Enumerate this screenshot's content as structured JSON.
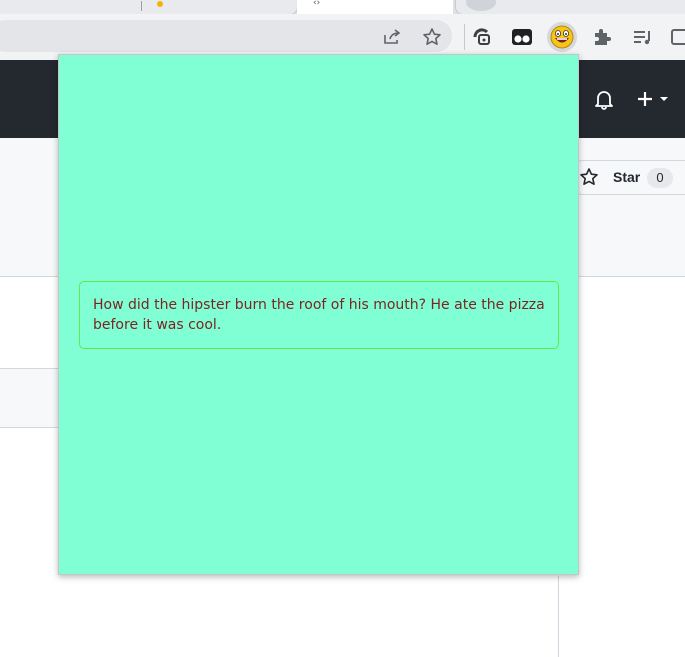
{
  "browser": {
    "extensions": [
      {
        "name": "ext-hollow-icon"
      },
      {
        "name": "ext-glasses-icon"
      },
      {
        "name": "ext-laughing-emoji-icon",
        "active": true
      }
    ]
  },
  "repo": {
    "star_label": "Star",
    "star_count": "0"
  },
  "popup": {
    "background": "#80ffd4",
    "joke": "How did the hipster burn the roof of his mouth? He ate the pizza before it was cool."
  }
}
